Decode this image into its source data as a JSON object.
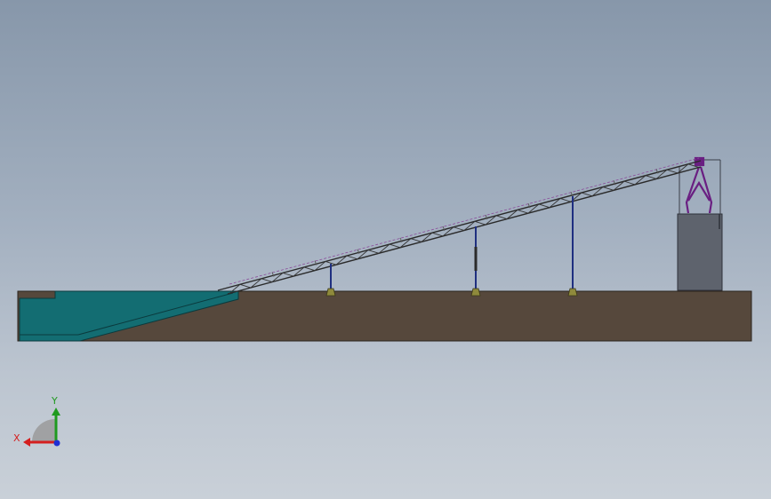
{
  "view": {
    "background_top": "#8797aa",
    "background_bottom": "#c9d0d8"
  },
  "model": {
    "ground_color": "#56483c",
    "pit_color": "#136d72",
    "tower_color": "#5e636d",
    "support_color": "#1f2f80",
    "footing_color": "#8f8a3c",
    "head_frame_color": "#6a1f82",
    "conveyor_color": "#1c1c1c"
  },
  "triad": {
    "x_label": "X",
    "y_label": "Y",
    "x_color": "#d41f1f",
    "y_color": "#1f9a1f",
    "z_color": "#1f2fd4"
  }
}
